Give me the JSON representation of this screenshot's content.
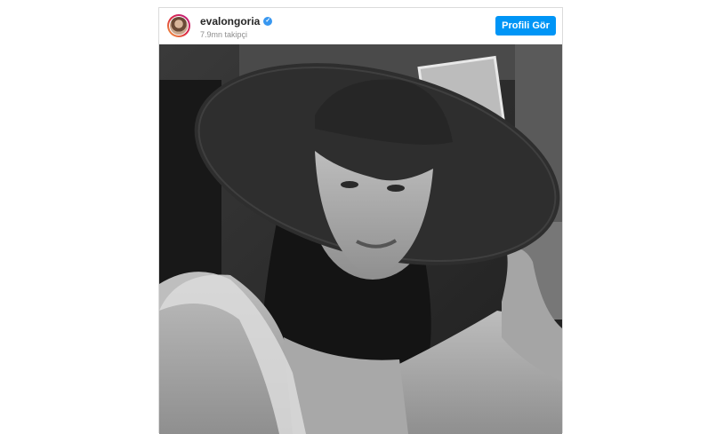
{
  "post": {
    "username": "evalongoria",
    "verified_icon": "verified-badge-icon",
    "followers": "7.9mn takipçi",
    "profile_button": "Profili Gör",
    "accent_color": "#0095f6"
  }
}
